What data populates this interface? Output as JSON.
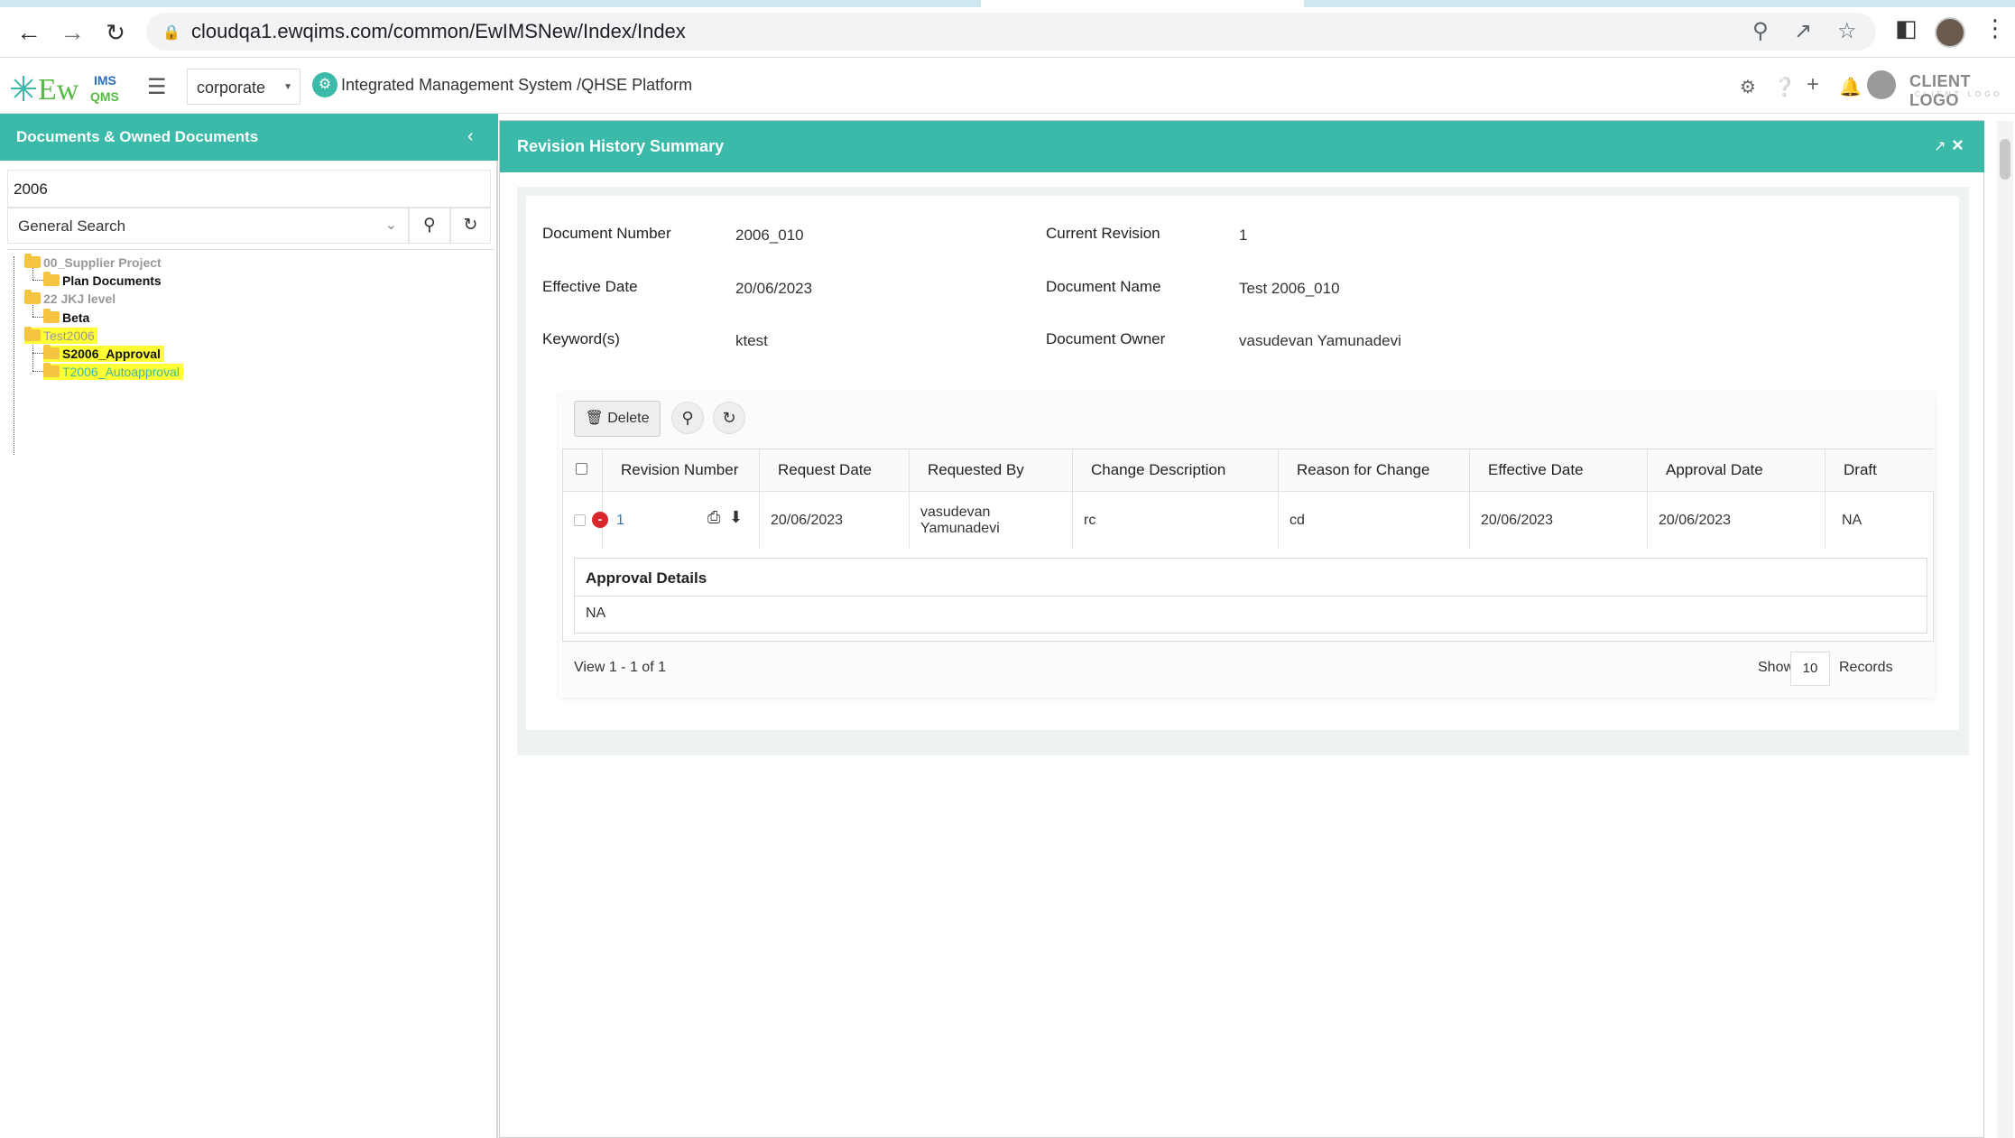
{
  "browser": {
    "url": "cloudqa1.ewqims.com/common/EwIMSNew/Index/Index"
  },
  "header": {
    "logo_text": "EwQIMS",
    "company_select": "corporate",
    "platform_title": "Integrated Management System /QHSE Platform",
    "client_logo": "CLIENT LOGO",
    "client_logo_sub": "CLIENT LOGO"
  },
  "sidebar": {
    "title": "Documents & Owned Documents",
    "search_value": "2006",
    "search_type": "General Search",
    "tree": [
      {
        "label": "00_Supplier Project",
        "level": 0,
        "style": "muted"
      },
      {
        "label": "Plan Documents",
        "level": 1,
        "style": "bold"
      },
      {
        "label": "22 JKJ level",
        "level": 0,
        "style": "muted"
      },
      {
        "label": "Beta",
        "level": 1,
        "style": "bold"
      },
      {
        "label": "Test2006",
        "level": 0,
        "style": "highlight"
      },
      {
        "label": "S2006_Approval",
        "level": 1,
        "style": "highlight-bold"
      },
      {
        "label": "T2006_Autoapproval",
        "level": 1,
        "style": "highlight-teal"
      }
    ]
  },
  "modal": {
    "title": "Revision History Summary",
    "fields": {
      "document_number_label": "Document Number",
      "document_number": "2006_010",
      "current_revision_label": "Current Revision",
      "current_revision": "1",
      "effective_date_label": "Effective Date",
      "effective_date": "20/06/2023",
      "document_name_label": "Document Name",
      "document_name": "Test 2006_010",
      "keywords_label": "Keyword(s)",
      "keywords": "ktest",
      "document_owner_label": "Document Owner",
      "document_owner": "vasudevan Yamunadevi"
    },
    "toolbar": {
      "delete_label": "Delete"
    },
    "table": {
      "columns": [
        "Revision Number",
        "Request Date",
        "Requested By",
        "Change Description",
        "Reason for Change",
        "Effective Date",
        "Approval Date",
        "Draft"
      ],
      "rows": [
        {
          "revision_number": "1",
          "request_date": "20/06/2023",
          "requested_by_line1": "vasudevan",
          "requested_by_line2": "Yamunadevi",
          "change_description": "rc",
          "reason_for_change": "cd",
          "effective_date": "20/06/2023",
          "approval_date": "20/06/2023",
          "draft": "NA"
        }
      ],
      "approval_details_label": "Approval Details",
      "approval_details_value": "NA"
    },
    "pager": {
      "summary": "View 1 - 1 of 1",
      "show_label": "Show",
      "page_size": "10",
      "records_label": "Records"
    }
  }
}
